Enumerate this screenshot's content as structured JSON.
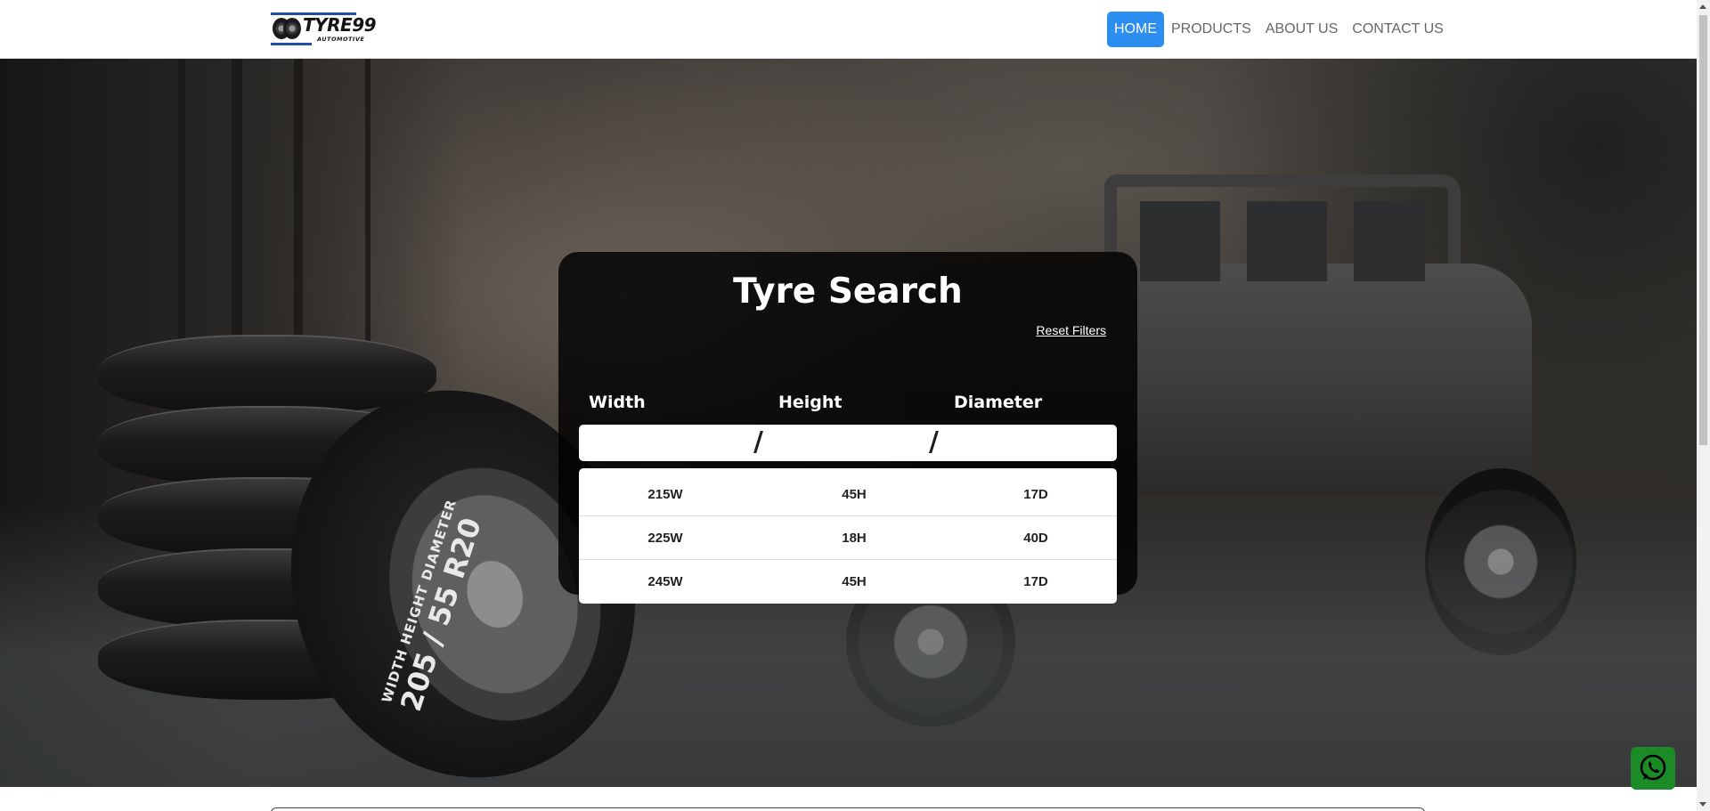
{
  "brand": {
    "logo_text": "TYRE99",
    "logo_subtext": "AUTOMOTIVE"
  },
  "nav": {
    "items": [
      {
        "label": "HOME",
        "active": true
      },
      {
        "label": "PRODUCTS",
        "active": false
      },
      {
        "label": "ABOUT US",
        "active": false
      },
      {
        "label": "CONTACT US",
        "active": false
      }
    ]
  },
  "hero": {
    "tyre_print": {
      "labels": "WIDTH   HEIGHT   DIAMETER",
      "size": "205 / 55 R20"
    }
  },
  "search": {
    "title": "Tyre Search",
    "reset_label": "Reset Filters",
    "fields": {
      "width_label": "Width",
      "height_label": "Height",
      "diameter_label": "Diameter",
      "width_value": "",
      "height_value": "",
      "diameter_value": "",
      "separator": "/"
    },
    "results": [
      {
        "width": "215W",
        "height": "45H",
        "diameter": "17D"
      },
      {
        "width": "225W",
        "height": "18H",
        "diameter": "40D"
      },
      {
        "width": "245W",
        "height": "45H",
        "diameter": "17D"
      }
    ]
  },
  "colors": {
    "nav_active": "#2b8ef0",
    "whatsapp": "#1c8a25",
    "card_bg": "#000000"
  },
  "icons": {
    "whatsapp": "whatsapp-icon"
  }
}
